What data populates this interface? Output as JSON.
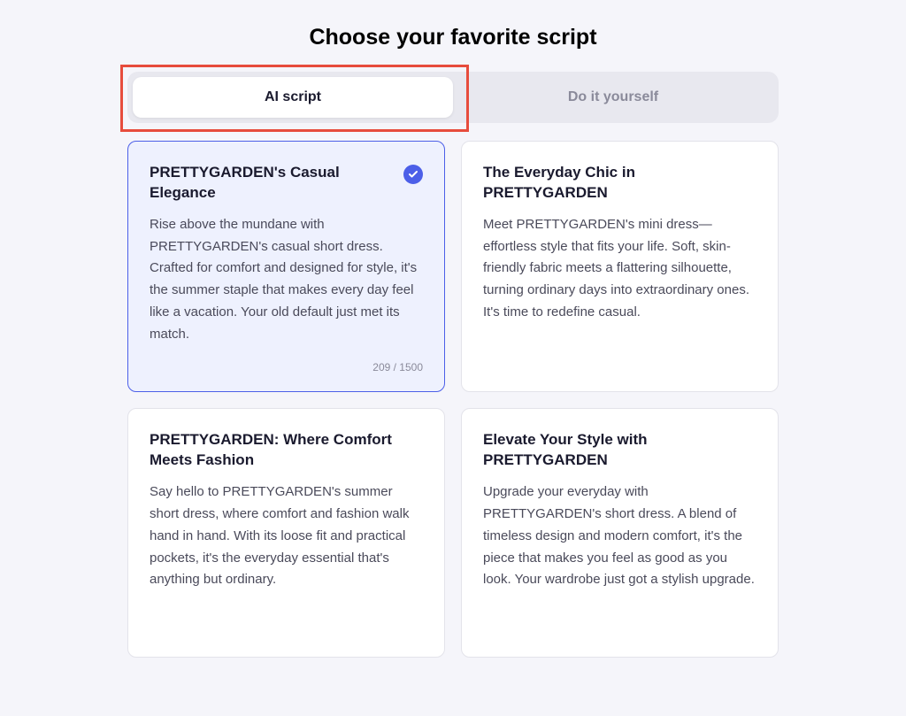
{
  "page_title": "Choose your favorite script",
  "tabs": {
    "ai_script": "AI script",
    "diy": "Do it yourself"
  },
  "scripts": [
    {
      "title": "PRETTYGARDEN's Casual Elegance",
      "body": "Rise above the mundane with PRETTYGARDEN's casual short dress. Crafted for comfort and designed for style, it's the summer staple that makes every day feel like a vacation. Your old default just met its match.",
      "selected": true,
      "char_count": "209 / 1500"
    },
    {
      "title": "The Everyday Chic in PRETTYGARDEN",
      "body": "Meet PRETTYGARDEN's mini dress—effortless style that fits your life. Soft, skin-friendly fabric meets a flattering silhouette, turning ordinary days into extraordinary ones. It's time to redefine casual.",
      "selected": false
    },
    {
      "title": "PRETTYGARDEN: Where Comfort Meets Fashion",
      "body": "Say hello to PRETTYGARDEN's summer short dress, where comfort and fashion walk hand in hand. With its loose fit and practical pockets, it's the everyday essential that's anything but ordinary.",
      "selected": false
    },
    {
      "title": "Elevate Your Style with PRETTYGARDEN",
      "body": "Upgrade your everyday with PRETTYGARDEN's short dress. A blend of timeless design and modern comfort, it's the piece that makes you feel as good as you look. Your wardrobe just got a stylish upgrade.",
      "selected": false
    }
  ]
}
